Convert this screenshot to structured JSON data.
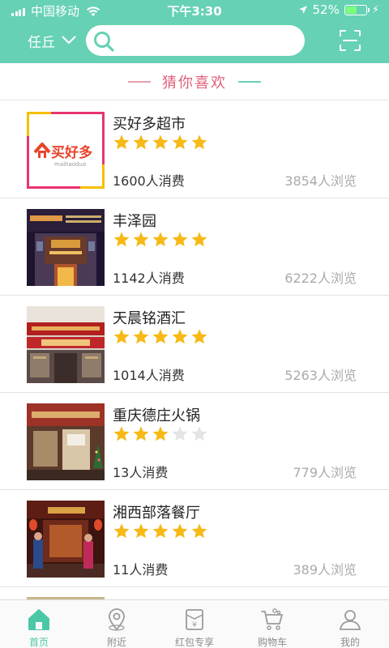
{
  "status_bar": {
    "carrier": "中国移动",
    "time": "下午3:30",
    "battery": "52%",
    "battery_level": 0.52
  },
  "header": {
    "city": "任丘",
    "search_placeholder": "",
    "icons": [
      "chevron-down-icon",
      "search-icon",
      "scan-icon"
    ]
  },
  "section_title": "猜你喜欢",
  "shops": [
    {
      "name": "买好多超市",
      "rating": 5,
      "sold": "1600人消费",
      "views": "3854人浏览",
      "thumb": "supermarket-logo"
    },
    {
      "name": "丰泽园",
      "rating": 5,
      "sold": "1142人消费",
      "views": "6222人浏览",
      "thumb": "restaurant-night-photo"
    },
    {
      "name": "天晨铭酒汇",
      "rating": 5,
      "sold": "1014人消费",
      "views": "5263人浏览",
      "thumb": "liquor-store-photo"
    },
    {
      "name": "重庆德庄火锅",
      "rating": 3,
      "sold": "13人消费",
      "views": "779人浏览",
      "thumb": "hotpot-storefront-photo"
    },
    {
      "name": "湘西部落餐厅",
      "rating": 5,
      "sold": "11人消费",
      "views": "389人浏览",
      "thumb": "restaurant-interior-photo"
    }
  ],
  "logo_text": {
    "main": "买好多",
    "sub": "maihaoduo"
  },
  "tabs": [
    {
      "label": "首页",
      "icon": "home-icon",
      "active": true
    },
    {
      "label": "附近",
      "icon": "location-icon",
      "active": false
    },
    {
      "label": "红包专享",
      "icon": "red-envelope-icon",
      "active": false
    },
    {
      "label": "购物车",
      "icon": "cart-icon",
      "active": false
    },
    {
      "label": "我的",
      "icon": "user-icon",
      "active": false
    }
  ],
  "colors": {
    "brand": "#66d1b5",
    "accent_title": "#e0607a",
    "star_on": "#f7b916",
    "star_off": "#e4e4e4",
    "tab_active": "#4cc7a6"
  }
}
